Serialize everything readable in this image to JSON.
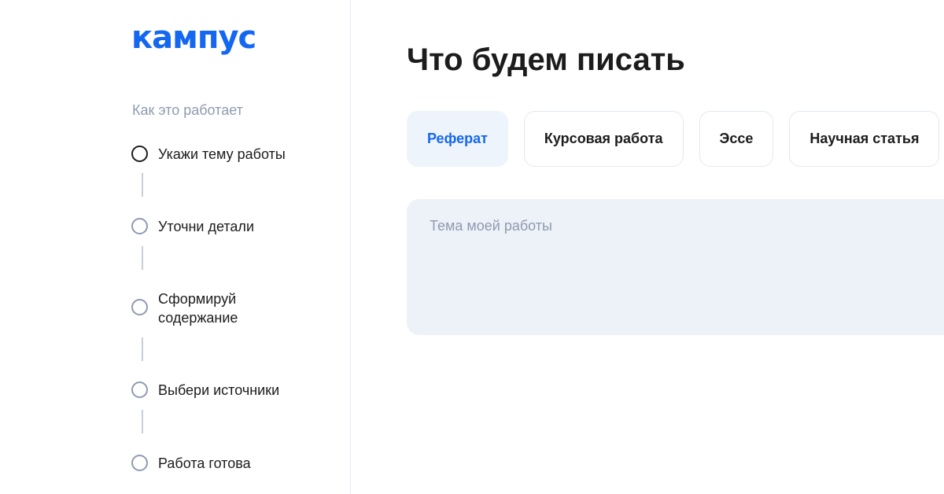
{
  "brand": {
    "logo_text": "кампус",
    "accent_color": "#1467f0"
  },
  "sidebar": {
    "heading": "Как это работает",
    "steps": [
      {
        "label": "Укажи тему работы",
        "state": "current"
      },
      {
        "label": "Уточни детали",
        "state": "pending"
      },
      {
        "label": "Сформируй содержание",
        "state": "pending"
      },
      {
        "label": "Выбери источники",
        "state": "pending"
      },
      {
        "label": "Работа готова",
        "state": "pending"
      }
    ]
  },
  "main": {
    "title": "Что будем писать",
    "tabs": [
      {
        "label": "Реферат",
        "selected": true
      },
      {
        "label": "Курсовая работа",
        "selected": false
      },
      {
        "label": "Эссе",
        "selected": false
      },
      {
        "label": "Научная статья",
        "selected": false
      }
    ],
    "topic_input": {
      "placeholder": "Тема моей работы",
      "value": ""
    }
  }
}
